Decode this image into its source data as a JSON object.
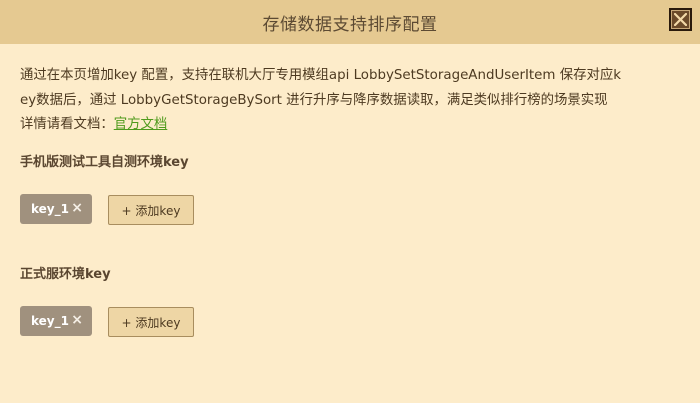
{
  "dialog": {
    "title": "存储数据支持排序配置",
    "close_icon": "close-icon"
  },
  "description": {
    "line1": "通过在本页增加key 配置，支持在联机大厅专用模组api LobbySetStorageAndUserItem 保存对应k",
    "line2": "ey数据后，通过 LobbyGetStorageBySort 进行升序与降序数据读取，满足类似排行榜的场景实现",
    "line3_prefix": "详情请看文档：",
    "doc_link": "官方文档"
  },
  "sections": [
    {
      "label": "手机版测试工具自测环境key",
      "tags": [
        "key_1"
      ],
      "remove_symbol": "×",
      "add_label": "+ 添加key"
    },
    {
      "label": "正式服环境key",
      "tags": [
        "key_1"
      ],
      "remove_symbol": "×",
      "add_label": "+ 添加key"
    }
  ],
  "colors": {
    "background": "#fdecca",
    "titlebar": "#e5c991",
    "tag": "#a0917e",
    "add_button": "#eed6a5",
    "link": "#4e9a1c"
  }
}
